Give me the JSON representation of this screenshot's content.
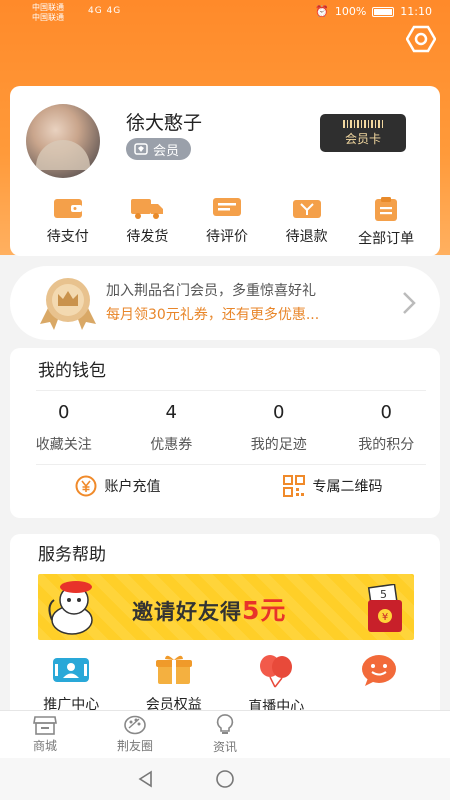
{
  "status_bar": {
    "carrier1": "中国联通",
    "carrier2": "中国联通",
    "signal_text": "4G 4G",
    "battery": "100%",
    "time": "11:10"
  },
  "profile": {
    "username": "徐大憨子",
    "member_label": "会员",
    "vip_card_label": "会员卡"
  },
  "orders": [
    {
      "label": "待支付",
      "icon": "wallet-icon"
    },
    {
      "label": "待发货",
      "icon": "truck-icon"
    },
    {
      "label": "待评价",
      "icon": "comment-icon"
    },
    {
      "label": "待退款",
      "icon": "refund-icon"
    },
    {
      "label": "全部订单",
      "icon": "clipboard-icon"
    }
  ],
  "promo": {
    "title": "加入荆品名门会员，多重惊喜好礼",
    "subtitle": "每月领30元礼券，还有更多优惠..."
  },
  "wallet": {
    "title": "我的钱包",
    "stats": [
      {
        "value": "0",
        "label": "收藏关注"
      },
      {
        "value": "4",
        "label": "优惠券"
      },
      {
        "value": "0",
        "label": "我的足迹"
      },
      {
        "value": "0",
        "label": "我的积分"
      }
    ],
    "actions": [
      {
        "label": "账户充值",
        "icon": "yen-coin-icon"
      },
      {
        "label": "专属二维码",
        "icon": "qrcode-icon"
      }
    ]
  },
  "service": {
    "title": "服务帮助",
    "banner_text": "邀请好友得",
    "banner_amount": "5元",
    "banner_envelope_value": "5",
    "items": [
      {
        "label": "推广中心",
        "icon": "id-card-icon"
      },
      {
        "label": "会员权益",
        "icon": "gift-icon"
      },
      {
        "label": "直播中心",
        "icon": "balloon-icon"
      },
      {
        "label": "",
        "icon": "chat-face-icon"
      }
    ]
  },
  "tabbar": [
    {
      "label": "商城",
      "icon": "store-icon"
    },
    {
      "label": "荆友圈",
      "icon": "palette-icon"
    },
    {
      "label": "资讯",
      "icon": "lightbulb-icon"
    },
    {
      "label": "",
      "icon": ""
    },
    {
      "label": "",
      "icon": ""
    }
  ],
  "colors": {
    "accent": "#ff8a2a",
    "promo_orange": "#e8862a",
    "banner_yellow": "#ffd43a",
    "banner_red": "#e8332a"
  }
}
